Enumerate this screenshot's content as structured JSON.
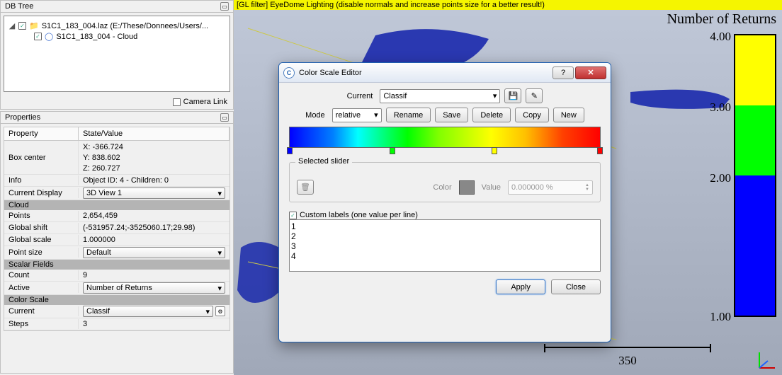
{
  "left": {
    "dbtree_title": "DB Tree",
    "file_name": "S1C1_183_004.laz (E:/These/Donnees/Users/...",
    "cloud_name": "S1C1_183_004 - Cloud",
    "camera_link": "Camera Link",
    "props_title": "Properties",
    "hdr_property": "Property",
    "hdr_value": "State/Value",
    "rows": [
      {
        "k": "Box center",
        "v": "X: -366.724",
        "v2": "Y: 838.602",
        "v3": "Z: 260.727"
      },
      {
        "k": "Info",
        "v": "Object ID: 4 - Children: 0"
      },
      {
        "k": "Current Display",
        "v": "3D View 1",
        "select": true,
        "btn": false
      }
    ],
    "sec_cloud": "Cloud",
    "points": {
      "k": "Points",
      "v": "2,654,459"
    },
    "gshift": {
      "k": "Global shift",
      "v": "(-531957.24;-3525060.17;29.98)"
    },
    "gscale": {
      "k": "Global scale",
      "v": "1.000000"
    },
    "psize": {
      "k": "Point size",
      "v": "Default",
      "select": true
    },
    "sec_sf": "Scalar Fields",
    "count": {
      "k": "Count",
      "v": "9"
    },
    "active": {
      "k": "Active",
      "v": "Number of Returns",
      "select": true
    },
    "sec_cs": "Color Scale",
    "current": {
      "k": "Current",
      "v": "Classif",
      "select": true,
      "btn": true
    },
    "steps": {
      "k": "Steps",
      "v": "3"
    }
  },
  "viewport": {
    "gl_filter": "[GL filter] EyeDome Lighting (disable normals and increase points size for a better result!)",
    "returns_title": "Number of Returns",
    "labels": [
      "4.00",
      "3.00",
      "2.00",
      "1.00"
    ],
    "colors": [
      "#ffff00",
      "#00ff00",
      "#0000ff",
      "#0000ff"
    ],
    "wait_colors": [
      "#ffff00",
      "#00ff00",
      "#0000ff",
      "#0000ff"
    ],
    "scale": "350"
  },
  "dialog": {
    "title": "Color Scale Editor",
    "current_label": "Current",
    "current_value": "Classif",
    "mode_label": "Mode",
    "mode_value": "relative",
    "rename": "Rename",
    "save": "Save",
    "delete": "Delete",
    "copy": "Copy",
    "new": "New",
    "selected_slider": "Selected slider",
    "color_label": "Color",
    "value_label": "Value",
    "value_value": "0.000000 %",
    "custom_labels": "Custom labels (one value per line)",
    "custom_text": "1\n2\n3\n4",
    "apply": "Apply",
    "close": "Close"
  }
}
